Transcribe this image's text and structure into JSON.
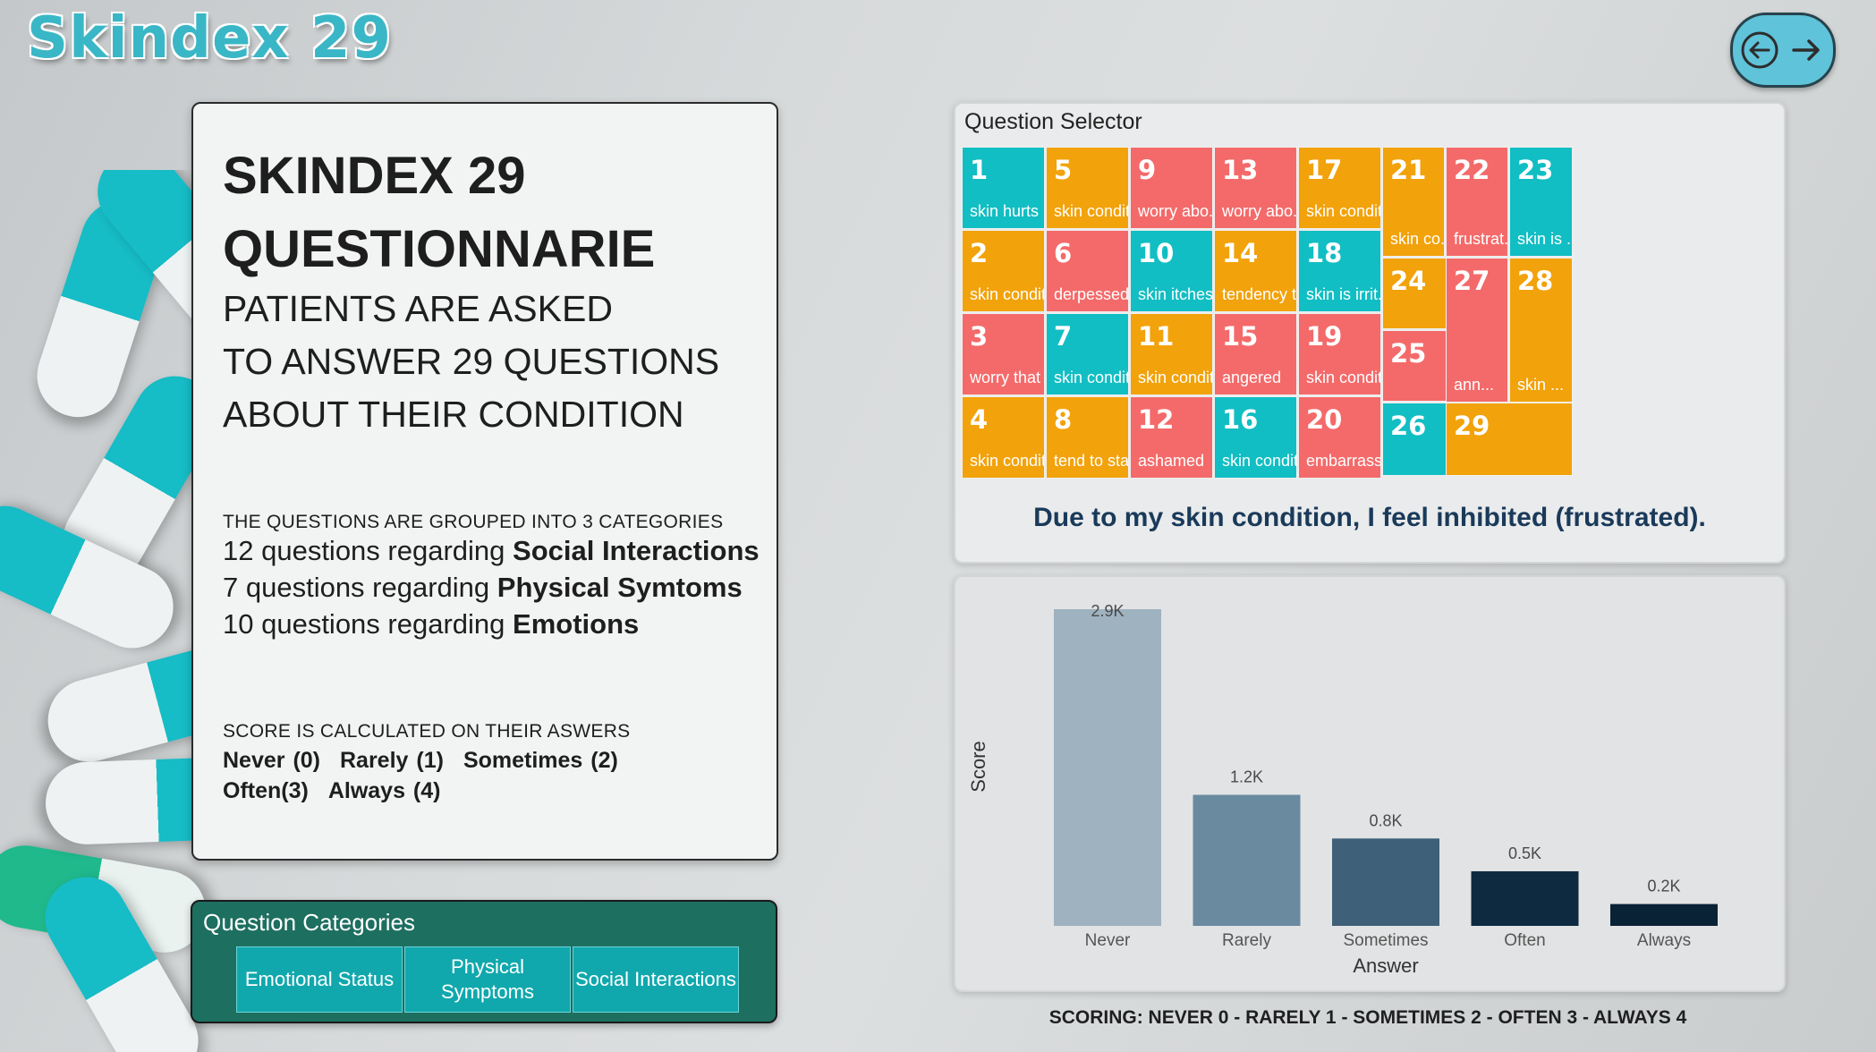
{
  "app_title": "Skindex 29",
  "nav": {
    "back_icon": "back-arrow-icon",
    "forward_icon": "forward-arrow-icon"
  },
  "info": {
    "heading": "SKINDEX 29 QUESTIONNARIE",
    "sub_lines": [
      "PATIENTS ARE ASKED",
      "TO ANSWER 29 QUESTIONS",
      "ABOUT THEIR CONDITION"
    ],
    "categories_intro": "THE QUESTIONS ARE GROUPED INTO 3 CATEGORIES",
    "category_lines": [
      {
        "prefix": "12 questions regarding",
        "bold": "Social Interactions"
      },
      {
        "prefix": "7 questions regarding",
        "bold": "Physical Symtoms"
      },
      {
        "prefix": "10 questions regarding",
        "bold": "Emotions"
      }
    ],
    "score_intro": "SCORE IS CALCULATED ON THEIR ASWERS",
    "score_row1": [
      "Never (0)",
      "Rarely (1)",
      "Sometimes (2)"
    ],
    "score_row2": [
      "Often(3)",
      "Always (4)"
    ]
  },
  "question_categories": {
    "title": "Question Categories",
    "buttons": [
      "Emotional Status",
      "Physical Symptoms",
      "Social Interactions"
    ]
  },
  "question_selector": {
    "title": "Question Selector",
    "tiles": [
      {
        "num": "1",
        "label": "skin hurts",
        "color": "#11bec3"
      },
      {
        "num": "2",
        "label": "skin condit...",
        "color": "#f2a20a"
      },
      {
        "num": "3",
        "label": "worry that ...",
        "color": "#f46a6a"
      },
      {
        "num": "4",
        "label": "skin condit...",
        "color": "#f2a20a"
      },
      {
        "num": "5",
        "label": "skin condit...",
        "color": "#f2a20a"
      },
      {
        "num": "6",
        "label": "derpessed",
        "color": "#f46a6a"
      },
      {
        "num": "7",
        "label": "skin condit...",
        "color": "#11bec3"
      },
      {
        "num": "8",
        "label": "tend to sta...",
        "color": "#f2a20a"
      },
      {
        "num": "9",
        "label": "worry abo...",
        "color": "#f46a6a"
      },
      {
        "num": "10",
        "label": "skin itches",
        "color": "#11bec3"
      },
      {
        "num": "11",
        "label": "skin condit...",
        "color": "#f2a20a"
      },
      {
        "num": "12",
        "label": "ashamed",
        "color": "#f46a6a"
      },
      {
        "num": "13",
        "label": "worry abo...",
        "color": "#f46a6a"
      },
      {
        "num": "14",
        "label": "tendency t...",
        "color": "#f2a20a"
      },
      {
        "num": "15",
        "label": "angered",
        "color": "#f46a6a"
      },
      {
        "num": "16",
        "label": "skin condit...",
        "color": "#11bec3"
      },
      {
        "num": "17",
        "label": "skin condit...",
        "color": "#f2a20a"
      },
      {
        "num": "18",
        "label": "skin is irrit...",
        "color": "#11bec3"
      },
      {
        "num": "19",
        "label": "skin condit...",
        "color": "#f46a6a"
      },
      {
        "num": "20",
        "label": "embarrass...",
        "color": "#f46a6a"
      },
      {
        "num": "21",
        "label": "skin co...",
        "color": "#f2a20a"
      },
      {
        "num": "22",
        "label": "frustrat...",
        "color": "#f46a6a"
      },
      {
        "num": "23",
        "label": "skin is ...",
        "color": "#11bec3"
      },
      {
        "num": "24",
        "label": "",
        "color": "#f2a20a"
      },
      {
        "num": "25",
        "label": "",
        "color": "#f46a6a"
      },
      {
        "num": "26",
        "label": "",
        "color": "#11bec3"
      },
      {
        "num": "27",
        "label": "ann...",
        "color": "#f46a6a"
      },
      {
        "num": "28",
        "label": "skin ...",
        "color": "#f2a20a"
      },
      {
        "num": "29",
        "label": "",
        "color": "#f2a20a"
      }
    ],
    "selected_question": "Due to my skin condition, I feel inhibited (frustrated)."
  },
  "chart_data": {
    "type": "bar",
    "categories": [
      "Never",
      "Rarely",
      "Sometimes",
      "Often",
      "Always"
    ],
    "values": [
      2900,
      1200,
      800,
      500,
      200
    ],
    "data_labels": [
      "2.9K",
      "1.2K",
      "0.8K",
      "0.5K",
      "0.2K"
    ],
    "colors": [
      "#9fb2c0",
      "#6a8aa0",
      "#3e6078",
      "#0e2a40",
      "#0a2236"
    ],
    "xlabel": "Answer",
    "ylabel": "Score",
    "ylim": [
      0,
      2900
    ],
    "grid": false
  },
  "scoring_footer": "SCORING:   NEVER 0 -   RARELY 1 - SOMETIMES 2 - OFTEN 3 - ALWAYS 4"
}
